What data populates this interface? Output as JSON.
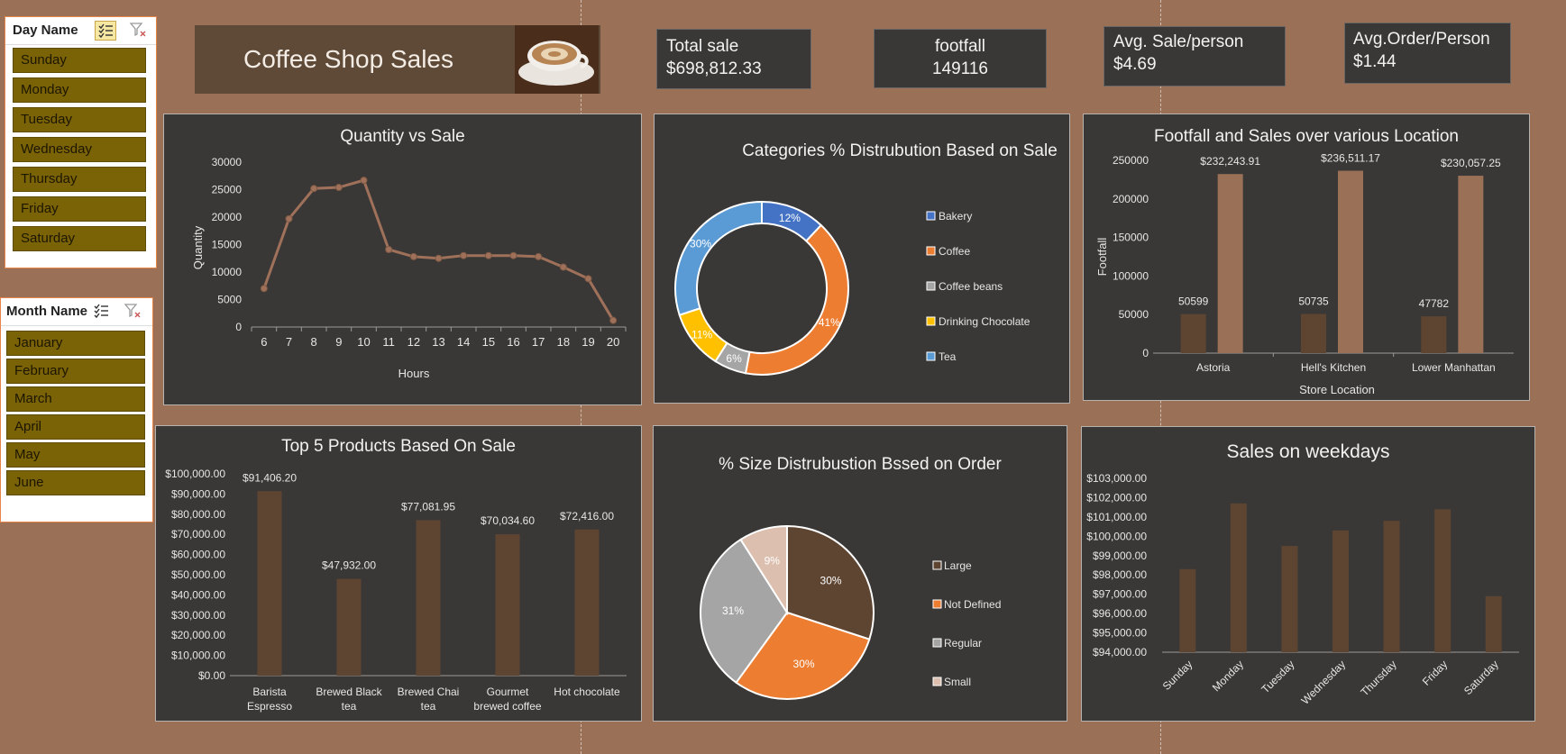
{
  "day_slicer": {
    "title": "Day Name",
    "items": [
      "Sunday",
      "Monday",
      "Tuesday",
      "Wednesday",
      "Thursday",
      "Friday",
      "Saturday"
    ]
  },
  "month_slicer": {
    "title": "Month Name",
    "items": [
      "January",
      "February",
      "March",
      "April",
      "May",
      "June"
    ]
  },
  "header": {
    "title": "Coffee Shop Sales"
  },
  "kpis": {
    "total_sale": {
      "label": "Total sale",
      "value": "$698,812.33"
    },
    "footfall": {
      "label": "footfall",
      "value": "149116"
    },
    "avg_sale": {
      "label": "Avg. Sale/person",
      "value": "$4.69"
    },
    "avg_order": {
      "label": "Avg.Order/Person",
      "value": "$1.44"
    }
  },
  "colors": {
    "background": "#9a7157",
    "panel": "#3a3836",
    "slicer_item": "#7a6207",
    "line": "#a0715a",
    "bar_dark": "#5e4532",
    "bar_light": "#9a7157",
    "bakery": "#4472c4",
    "coffee": "#ed7d31",
    "beans": "#a5a5a5",
    "choc": "#ffc000",
    "tea": "#5b9bd5",
    "large": "#5e4532",
    "small": "#dcbfae"
  },
  "chart_data": [
    {
      "id": "quantity",
      "type": "line",
      "title": "Quantity vs Sale",
      "xlabel": "Hours",
      "ylabel": "Quantity",
      "ylim": [
        0,
        30000
      ],
      "yticks": [
        "30000",
        "25000",
        "20000",
        "15000",
        "10000",
        "5000",
        "0"
      ],
      "x": [
        "6",
        "7",
        "8",
        "9",
        "10",
        "11",
        "12",
        "13",
        "14",
        "15",
        "16",
        "17",
        "18",
        "19",
        "20"
      ],
      "values": [
        7000,
        19700,
        25200,
        25400,
        26700,
        14100,
        12800,
        12500,
        13000,
        13000,
        13000,
        12800,
        10900,
        8800,
        1200
      ]
    },
    {
      "id": "categories",
      "type": "pie",
      "title": "Categories % Distrubution Based on Sale",
      "labels": [
        "Bakery",
        "Coffee",
        "Coffee beans",
        "Drinking Chocolate",
        "Tea"
      ],
      "values": [
        12,
        41,
        6,
        11,
        30
      ],
      "display": [
        "12%",
        "41%",
        "6%",
        "11%",
        "30%"
      ]
    },
    {
      "id": "location",
      "type": "bar",
      "title": "Footfall and Sales over various Location",
      "xlabel": "Store Location",
      "ylabel": "Footfall",
      "ylim": [
        0,
        250000
      ],
      "yticks": [
        "250000",
        "200000",
        "150000",
        "100000",
        "50000",
        "0"
      ],
      "categories": [
        "Astoria",
        "Hell's Kitchen",
        "Lower Manhattan"
      ],
      "series": [
        {
          "values": [
            50599,
            50735,
            47782
          ],
          "labels": [
            "50599",
            "50735",
            "47782"
          ]
        },
        {
          "values": [
            232243.91,
            236511.17,
            230057.25
          ],
          "labels": [
            "$232,243.91",
            "$236,511.17",
            "$230,057.25"
          ]
        }
      ]
    },
    {
      "id": "top5",
      "type": "bar",
      "title": "Top 5 Products Based On Sale",
      "ylim": [
        0,
        100000
      ],
      "yticks": [
        "$100,000.00",
        "$90,000.00",
        "$80,000.00",
        "$70,000.00",
        "$60,000.00",
        "$50,000.00",
        "$40,000.00",
        "$30,000.00",
        "$20,000.00",
        "$10,000.00",
        "$0.00"
      ],
      "categories": [
        [
          "Barista",
          "Espresso"
        ],
        [
          "Brewed Black",
          "tea"
        ],
        [
          "Brewed Chai",
          "tea"
        ],
        [
          "Gourmet",
          "brewed coffee"
        ],
        [
          "Hot chocolate"
        ]
      ],
      "values": [
        91406.2,
        47932.0,
        77081.95,
        70034.6,
        72416.0
      ],
      "labels": [
        "$91,406.20",
        "$47,932.00",
        "$77,081.95",
        "$70,034.60",
        "$72,416.00"
      ]
    },
    {
      "id": "size",
      "type": "pie",
      "title": "% Size Distrubustion Bssed on Order",
      "labels": [
        "Large",
        "Not Defined",
        "Regular",
        "Small"
      ],
      "values": [
        30,
        30,
        31,
        9
      ],
      "display": [
        "30%",
        "30%",
        "31%",
        "9%"
      ]
    },
    {
      "id": "weekdays",
      "type": "bar",
      "title": "Sales on weekdays",
      "ylim": [
        94000,
        103000
      ],
      "yticks": [
        "$103,000.00",
        "$102,000.00",
        "$101,000.00",
        "$100,000.00",
        "$99,000.00",
        "$98,000.00",
        "$97,000.00",
        "$96,000.00",
        "$95,000.00",
        "$94,000.00"
      ],
      "categories": [
        "Sunday",
        "Monday",
        "Tuesday",
        "Wednesday",
        "Thursday",
        "Friday",
        "Saturday"
      ],
      "values": [
        98300,
        101700,
        99500,
        100300,
        100800,
        101400,
        96900
      ]
    }
  ]
}
